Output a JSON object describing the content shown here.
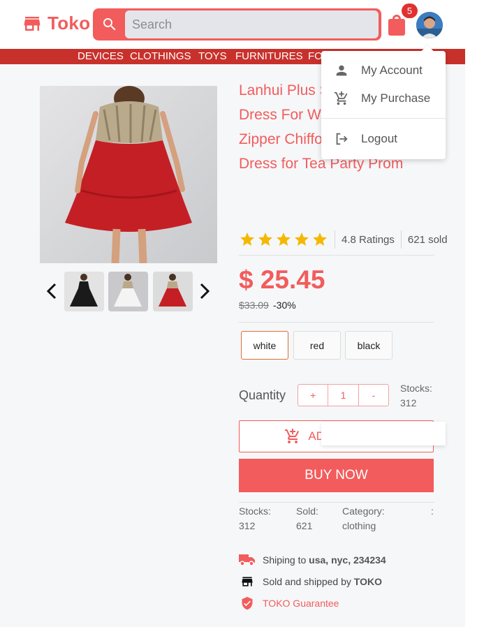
{
  "header": {
    "brand": "Toko",
    "search_placeholder": "Search",
    "cart_count": "5",
    "brand_color": "#f25c5c"
  },
  "categories": [
    "DEVICES",
    "CLOTHINGS",
    "TOYS",
    "FURNITURES",
    "FO"
  ],
  "account_menu": {
    "items": [
      {
        "label": "My Account",
        "icon": "person-icon"
      },
      {
        "label": "My Purchase",
        "icon": "cart-plus-icon"
      },
      {
        "label": "Logout",
        "icon": "logout-icon"
      }
    ]
  },
  "product": {
    "title": "Lanhui Plus Size Sleeveless Dress For Women O-Neck Zipper Chiffon Sequined Midi Dress for Tea Party Prom",
    "rating_stars": 5,
    "ratings": "4.8 Ratings",
    "sold": "621 sold",
    "price": "$ 25.45",
    "old_price": "$33.09",
    "discount": "-30%",
    "variants": [
      "white",
      "red",
      "black"
    ],
    "selected_variant": "white",
    "quantity_label": "Quantity",
    "quantity_minus_left": "+",
    "quantity_value": "1",
    "quantity_right": "-",
    "stocks_label": "Stocks:",
    "stocks_value": "312",
    "add_to_cart": "ADD TO CART",
    "buy_now": "BUY NOW",
    "info": {
      "stocks_label": "Stocks:",
      "stocks_value": "312",
      "sold_label": "Sold:",
      "sold_value": "621",
      "category_label": "Category:",
      "category_value": "clothing",
      "extra": ":"
    },
    "shipping": {
      "ship_prefix": "Shiping to",
      "ship_location": "usa, nyc, 234234",
      "sold_prefix": "Sold and shipped by",
      "seller": "TOKO",
      "guarantee": "TOKO Guarantee"
    }
  }
}
